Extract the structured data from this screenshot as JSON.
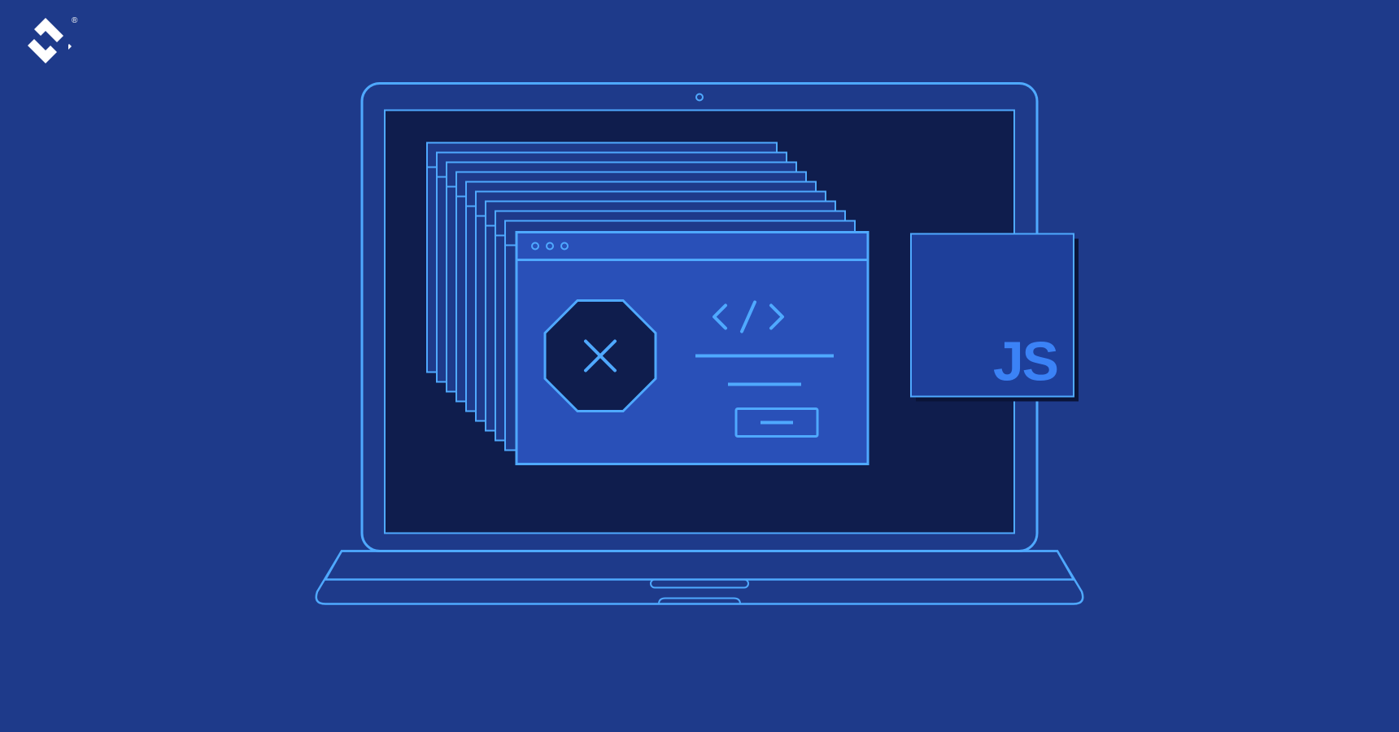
{
  "logo": {
    "registered_mark": "®"
  },
  "illustration": {
    "js_badge_text": "JS",
    "colors": {
      "background": "#1e3a8a",
      "outline": "#4fa9ff",
      "dark_navy": "#0f1d4d",
      "mid_blue": "#2950b8",
      "light_blue": "#3b82f6"
    },
    "elements": {
      "laptop": "laptop outline",
      "windows_stack": "stacked browser windows",
      "error_octagon": "octagon error icon with X",
      "code_symbol": "</> code brackets",
      "js_badge": "JavaScript logo square"
    }
  }
}
